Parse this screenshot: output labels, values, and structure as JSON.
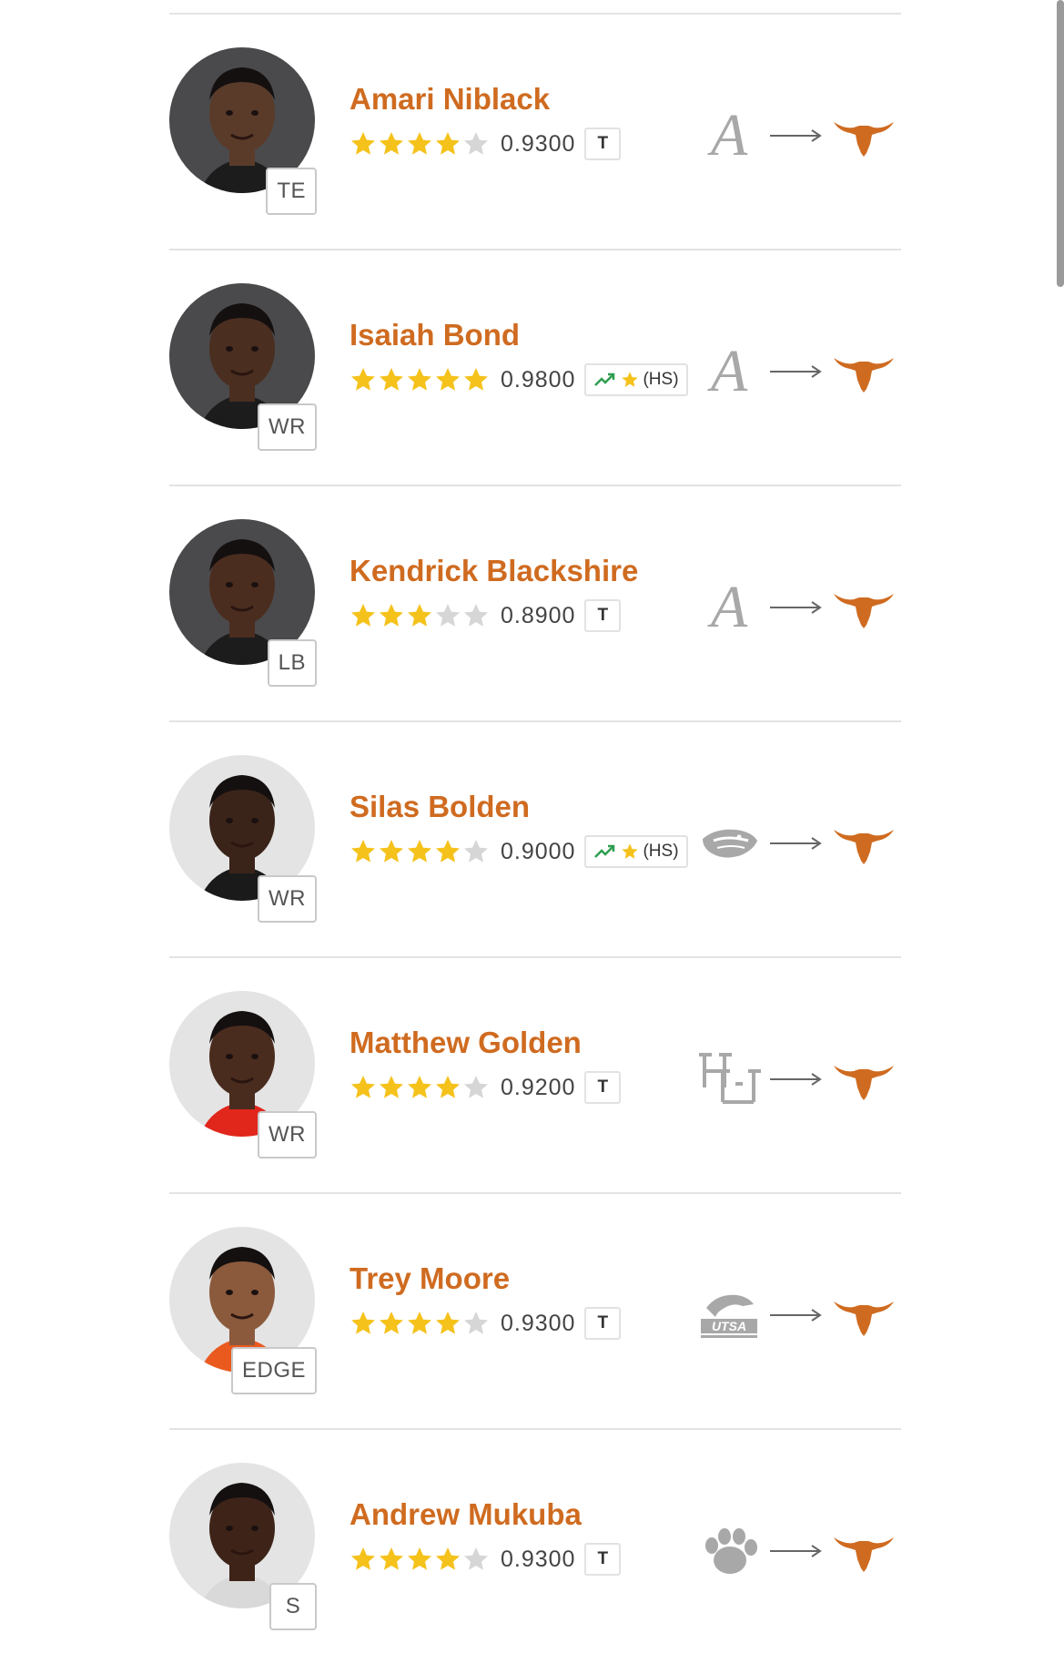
{
  "players": [
    {
      "name": "Amari Niblack",
      "position": "TE",
      "stars_filled": 4,
      "rating": "0.9300",
      "tag": "T",
      "tag_type": "transfer",
      "from_school": "Alabama",
      "from_logo": "alabama-logo-icon",
      "to_school": "Texas",
      "skin": "#5a3b2a",
      "jersey": "#1c1c1c",
      "bg": "dark"
    },
    {
      "name": "Isaiah Bond",
      "position": "WR",
      "stars_filled": 5,
      "rating": "0.9800",
      "tag": "(HS)",
      "tag_type": "hs",
      "from_school": "Alabama",
      "from_logo": "alabama-logo-icon",
      "to_school": "Texas",
      "skin": "#4a2e20",
      "jersey": "#1c1c1c",
      "bg": "dark"
    },
    {
      "name": "Kendrick Blackshire",
      "position": "LB",
      "stars_filled": 3,
      "rating": "0.8900",
      "tag": "T",
      "tag_type": "transfer",
      "from_school": "Alabama",
      "from_logo": "alabama-logo-icon",
      "to_school": "Texas",
      "skin": "#4b2d1f",
      "jersey": "#1c1c1c",
      "bg": "dark"
    },
    {
      "name": "Silas Bolden",
      "position": "WR",
      "stars_filled": 4,
      "rating": "0.9000",
      "tag": "(HS)",
      "tag_type": "hs",
      "from_school": "Oregon State",
      "from_logo": "oregon-state-logo-icon",
      "to_school": "Texas",
      "skin": "#3a2419",
      "jersey": "#1a1a1a",
      "bg": "light"
    },
    {
      "name": "Matthew Golden",
      "position": "WR",
      "stars_filled": 4,
      "rating": "0.9200",
      "tag": "T",
      "tag_type": "transfer",
      "from_school": "Houston",
      "from_logo": "houston-logo-icon",
      "to_school": "Texas",
      "skin": "#4a2c1e",
      "jersey": "#e1261c",
      "bg": "light"
    },
    {
      "name": "Trey Moore",
      "position": "EDGE",
      "stars_filled": 4,
      "rating": "0.9300",
      "tag": "T",
      "tag_type": "transfer",
      "from_school": "UTSA",
      "from_logo": "utsa-logo-icon",
      "to_school": "Texas",
      "skin": "#8b5a3c",
      "jersey": "#ea5a1e",
      "bg": "light"
    },
    {
      "name": "Andrew Mukuba",
      "position": "S",
      "stars_filled": 4,
      "rating": "0.9300",
      "tag": "T",
      "tag_type": "transfer",
      "from_school": "Clemson",
      "from_logo": "clemson-logo-icon",
      "to_school": "Texas",
      "skin": "#3e2418",
      "jersey": "#d9d9d9",
      "bg": "light"
    }
  ],
  "colors": {
    "accent": "#cf6b20",
    "star": "#f5c21b",
    "star_empty": "#d6d6d6",
    "trend": "#2e9e4f",
    "logo_gray": "#a8a8a8"
  }
}
